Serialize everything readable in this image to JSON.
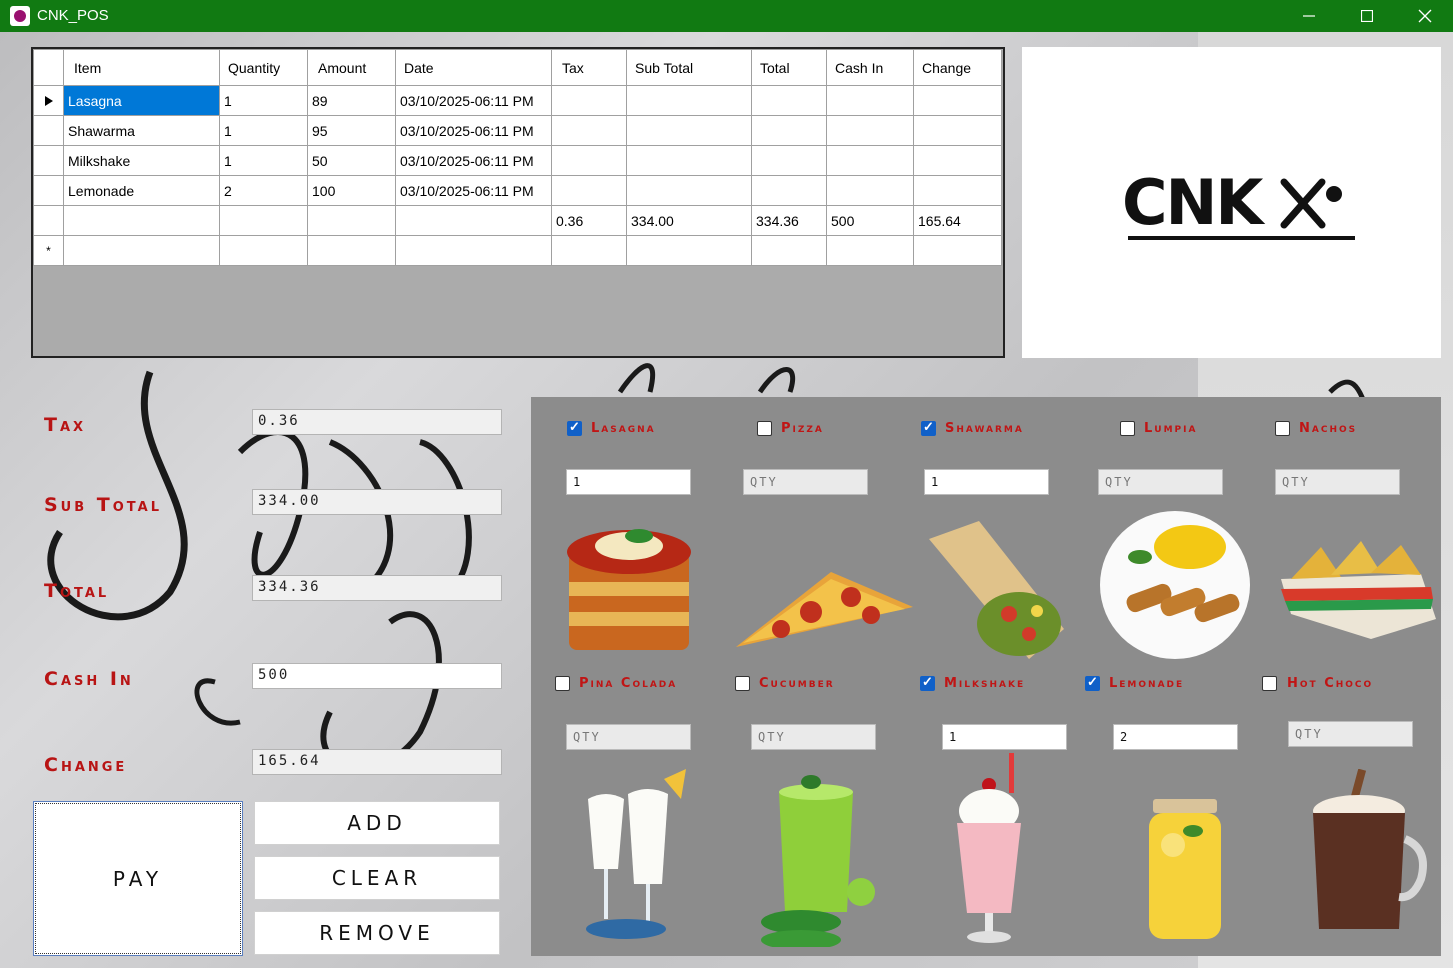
{
  "window": {
    "title": "CNK_POS",
    "minimize": "—",
    "maximize": "☐",
    "close": "✕"
  },
  "grid": {
    "columns": [
      "Item",
      "Quantity",
      "Amount",
      "Date",
      "Tax",
      "Sub Total",
      "Total",
      "Cash In",
      "Change"
    ],
    "rows": [
      [
        "Lasagna",
        "1",
        "89",
        "03/10/2025-06:11 PM",
        "",
        "",
        "",
        "",
        ""
      ],
      [
        "Shawarma",
        "1",
        "95",
        "03/10/2025-06:11 PM",
        "",
        "",
        "",
        "",
        ""
      ],
      [
        "Milkshake",
        "1",
        "50",
        "03/10/2025-06:11 PM",
        "",
        "",
        "",
        "",
        ""
      ],
      [
        "Lemonade",
        "2",
        "100",
        "03/10/2025-06:11 PM",
        "",
        "",
        "",
        "",
        ""
      ],
      [
        "",
        "",
        "",
        "",
        "0.36",
        "334.00",
        "334.36",
        "500",
        "165.64"
      ],
      [
        "",
        "",
        "",
        "",
        "",
        "",
        "",
        "",
        ""
      ]
    ],
    "new_row_marker": "*"
  },
  "logo": {
    "text": "CNK"
  },
  "summary": {
    "tax_label": "Tax",
    "tax_value": "0.36",
    "subtotal_label": "Sub Total",
    "subtotal_value": "334.00",
    "total_label": "Total",
    "total_value": "334.36",
    "cashin_label": "Cash In",
    "cashin_value": "500",
    "change_label": "Change",
    "change_value": "165.64"
  },
  "buttons": {
    "pay": "PAY",
    "add": "ADD",
    "clear": "CLEAR",
    "remove": "REMOVE"
  },
  "products": [
    {
      "name": "Lasagna",
      "checked": true,
      "qty": "1",
      "placeholder": "QTY"
    },
    {
      "name": "Pizza",
      "checked": false,
      "qty": "",
      "placeholder": "QTY"
    },
    {
      "name": "Shawarma",
      "checked": true,
      "qty": "1",
      "placeholder": "QTY"
    },
    {
      "name": "Lumpia",
      "checked": false,
      "qty": "",
      "placeholder": "QTY"
    },
    {
      "name": "Nachos",
      "checked": false,
      "qty": "",
      "placeholder": "QTY"
    },
    {
      "name": "Pina Colada",
      "checked": false,
      "qty": "",
      "placeholder": "QTY"
    },
    {
      "name": "Cucumber",
      "checked": false,
      "qty": "",
      "placeholder": "QTY"
    },
    {
      "name": "Milkshake",
      "checked": true,
      "qty": "1",
      "placeholder": "QTY"
    },
    {
      "name": "Lemonade",
      "checked": true,
      "qty": "2",
      "placeholder": "QTY"
    },
    {
      "name": "Hot Choco",
      "checked": false,
      "qty": "",
      "placeholder": "QTY"
    }
  ],
  "colors": {
    "titlebar": "#117a12",
    "label_red": "#b81414",
    "selection": "#0078d7",
    "checkbox": "#1060c8",
    "panel": "#8c8c8c"
  }
}
